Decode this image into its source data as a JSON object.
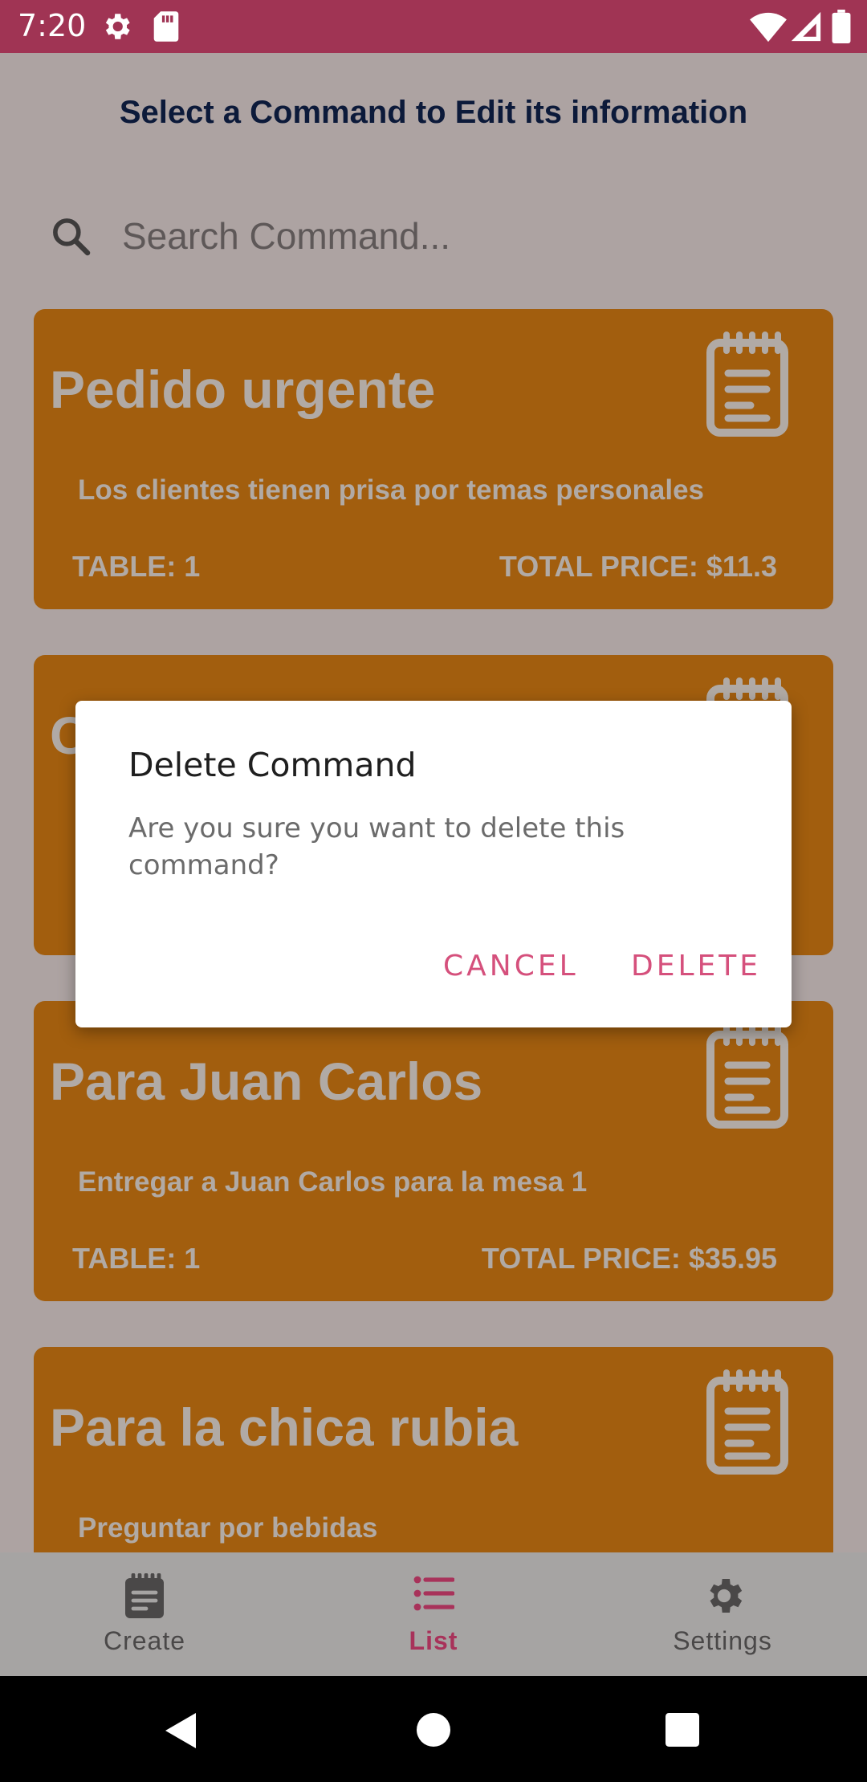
{
  "status_bar": {
    "time": "7:20",
    "icons": [
      "gear-icon",
      "sd-card-icon",
      "wifi-icon",
      "signal-icon",
      "battery-icon"
    ],
    "color": "#a03454"
  },
  "header": {
    "title": "Select a Command to Edit its information"
  },
  "search": {
    "placeholder": "Search Command..."
  },
  "commands": [
    {
      "title": "Pedido urgente",
      "description": "Los clientes tienen prisa por temas personales",
      "table": "TABLE: 1",
      "price": "TOTAL PRICE: $11.3"
    },
    {
      "title": "C",
      "description": "",
      "table": "",
      "price": ""
    },
    {
      "title": "Para Juan Carlos",
      "description": "Entregar a Juan Carlos para la mesa 1",
      "table": "TABLE: 1",
      "price": "TOTAL PRICE: $35.95"
    },
    {
      "title": "Para la chica rubia",
      "description": "Preguntar por bebidas",
      "table": "",
      "price": ""
    }
  ],
  "dialog": {
    "title": "Delete Command",
    "message": "Are you sure you want to delete this command?",
    "cancel_label": "CANCEL",
    "delete_label": "DELETE",
    "accent": "#d5507c"
  },
  "bottom_nav": {
    "items": [
      {
        "label": "Create",
        "icon": "clipboard-icon",
        "active": false
      },
      {
        "label": "List",
        "icon": "list-icon",
        "active": true
      },
      {
        "label": "Settings",
        "icon": "gear-icon",
        "active": false
      }
    ],
    "active_color": "#a8325a"
  },
  "card_color": "#a25e0e"
}
